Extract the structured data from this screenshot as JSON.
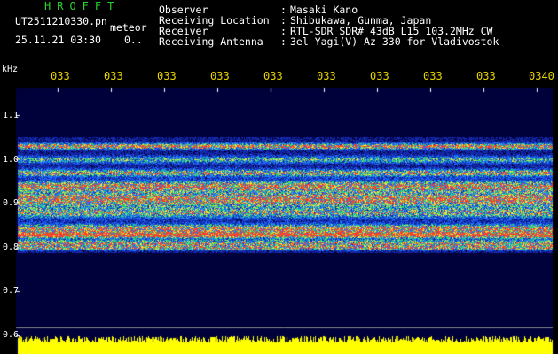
{
  "header": {
    "title": "HROFFT",
    "filename": "UT2511210330.pn",
    "meteor_label": "meteor",
    "datetime": "25.11.21 03:30",
    "count": "0.."
  },
  "info": [
    {
      "key": "Observer",
      "value": "Masaki Kano"
    },
    {
      "key": "Receiving Location",
      "value": "Shibukawa, Gunma, Japan"
    },
    {
      "key": "Receiver",
      "value": "RTL-SDR SDR# 43dB L15 103.2MHz CW"
    },
    {
      "key": "Receiving Antenna",
      "value": "3el Yagi(V) Az 330 for Vladivostok"
    }
  ],
  "axis": {
    "y_unit": "kHz",
    "x_ticks": [
      "033",
      "033",
      "033",
      "033",
      "033",
      "033",
      "033",
      "033",
      "033",
      "0340"
    ],
    "y_ticks": [
      "1.1",
      "1.0",
      "0.9",
      "0.8",
      "0.7",
      "0.6"
    ],
    "y_range": [
      0.59,
      1.14
    ]
  },
  "colors": {
    "background": "#000000",
    "title": "#2ad32a",
    "tick_text": "#e8d400",
    "strong_echo": "#ff3030",
    "noise_band": "#2a5cff",
    "level_bar": "#ffff00",
    "plot_bg": "#00003a"
  }
}
